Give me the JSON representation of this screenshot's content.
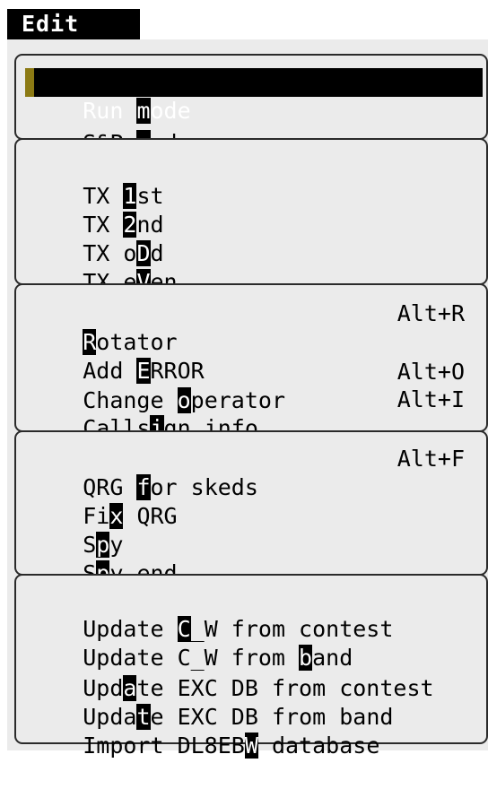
{
  "menu": {
    "title": "Edit",
    "sections": [
      {
        "items": [
          {
            "pre": "Run ",
            "hot": "m",
            "post": "ode",
            "shortcut": "",
            "selected": true
          },
          {
            "pre": "S&P ",
            "hot": "m",
            "post": "ode",
            "shortcut": ""
          }
        ]
      },
      {
        "items": [
          {
            "pre": "TX ",
            "hot": "1",
            "post": "st",
            "shortcut": ""
          },
          {
            "pre": "TX ",
            "hot": "2",
            "post": "nd",
            "shortcut": ""
          },
          {
            "pre": "TX o",
            "hot": "D",
            "post": "d",
            "shortcut": ""
          },
          {
            "pre": "TX e",
            "hot": "V",
            "post": "en",
            "shortcut": ""
          }
        ]
      },
      {
        "items": [
          {
            "pre": "",
            "hot": "R",
            "post": "otator",
            "shortcut": "Alt+R"
          },
          {
            "pre": "Add ",
            "hot": "E",
            "post": "RROR",
            "shortcut": ""
          },
          {
            "pre": "Change ",
            "hot": "o",
            "post": "perator",
            "shortcut": "Alt+O"
          },
          {
            "pre": "Calls",
            "hot": "i",
            "post": "gn info",
            "shortcut": "Alt+I"
          }
        ]
      },
      {
        "items": [
          {
            "pre": "QRG ",
            "hot": "f",
            "post": "or skeds",
            "shortcut": "Alt+F"
          },
          {
            "pre": "Fi",
            "hot": "x",
            "post": " QRG",
            "shortcut": ""
          },
          {
            "pre": "S",
            "hot": "p",
            "post": "y",
            "shortcut": ""
          },
          {
            "pre": "S",
            "hot": "p",
            "post": "y end",
            "shortcut": ""
          }
        ]
      },
      {
        "items": [
          {
            "pre": "Update ",
            "hot": "C",
            "post": "_W from contest",
            "shortcut": ""
          },
          {
            "pre": "Update C_W from ",
            "hot": "b",
            "post": "and",
            "shortcut": ""
          },
          {
            "pre": "Upd",
            "hot": "a",
            "post": "te EXC DB from contest",
            "shortcut": ""
          },
          {
            "pre": "Upda",
            "hot": "t",
            "post": "e EXC DB from band",
            "shortcut": ""
          },
          {
            "pre": "Import DL8EB",
            "hot": "W",
            "post": " database",
            "shortcut": ""
          }
        ]
      }
    ]
  }
}
